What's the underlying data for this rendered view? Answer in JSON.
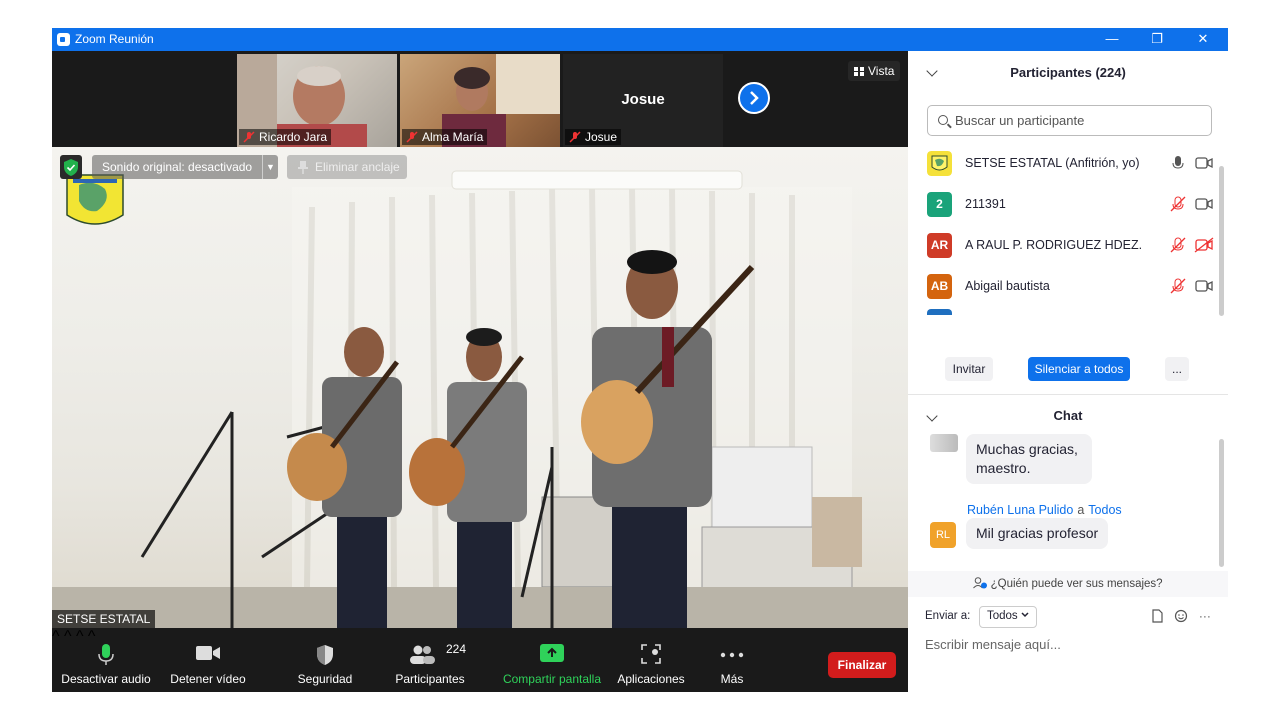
{
  "window": {
    "title": "Zoom Reunión",
    "minimize": "—",
    "restore": "❐",
    "close": "✕"
  },
  "strip": {
    "thumbs": [
      {
        "name": "Ricardo Jara"
      },
      {
        "name": "Alma María"
      },
      {
        "name": "Josue",
        "center_name": "Josue"
      }
    ],
    "view_label": "Vista"
  },
  "main": {
    "sound_label": "Sonido original: desactivado",
    "unpin_label": "Eliminar anclaje",
    "self_name": "SETSE ESTATAL"
  },
  "toolbar": {
    "mute": "Desactivar audio",
    "video": "Detener vídeo",
    "security": "Seguridad",
    "participants": "Participantes",
    "participants_count": "224",
    "share": "Compartir pantalla",
    "apps": "Aplicaciones",
    "more": "Más",
    "end": "Finalizar"
  },
  "participants": {
    "title": "Participantes (224)",
    "search_placeholder": "Buscar un participante",
    "list": [
      {
        "name": "SETSE ESTATAL (Anfitrión, yo)",
        "avatar": "",
        "color": "#f5e13a"
      },
      {
        "name": "211391",
        "avatar": "2",
        "color": "#1aa37a"
      },
      {
        "name": "A RAUL P. RODRIGUEZ HDEZ.",
        "avatar": "AR",
        "color": "#cf3b27"
      },
      {
        "name": "Abigail bautista",
        "avatar": "AB",
        "color": "#d4640e"
      }
    ],
    "invite": "Invitar",
    "mute_all": "Silenciar a todos",
    "more": "..."
  },
  "chat": {
    "title": "Chat",
    "message1": "Muchas gracias, maestro.",
    "sender": "Rubén Luna Pulido",
    "to_word": "a",
    "to_target": "Todos",
    "sender_avatar": "RL",
    "message2": "Mil gracias profesor",
    "who_can_see": "¿Quién puede ver sus mensajes?",
    "send_to_label": "Enviar a:",
    "send_to_value": "Todos",
    "compose_placeholder": "Escribir mensaje aquí...",
    "more": "···"
  }
}
